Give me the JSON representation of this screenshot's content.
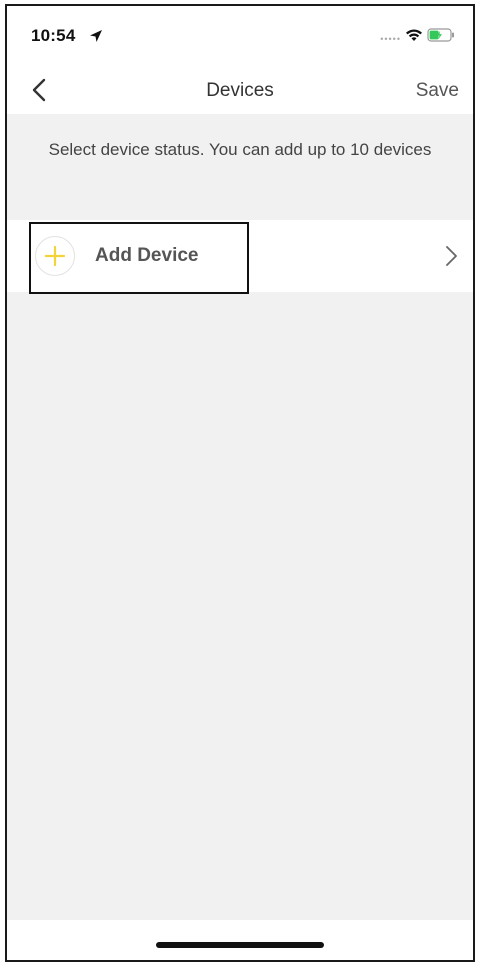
{
  "status_bar": {
    "time": "10:54",
    "icons": [
      "location-arrow-icon",
      "signal-icon",
      "wifi-icon",
      "battery-charging-icon"
    ]
  },
  "nav": {
    "title": "Devices",
    "save_label": "Save",
    "back_icon": "chevron-left-icon"
  },
  "description": "Select device status. You can add up to 10 devices",
  "add_device": {
    "label": "Add Device",
    "icon": "plus-icon",
    "chevron_icon": "chevron-right-icon"
  },
  "colors": {
    "accent_plus": "#f3d23a",
    "background": "#f1f1f1",
    "surface": "#ffffff",
    "battery_green": "#34c759"
  }
}
